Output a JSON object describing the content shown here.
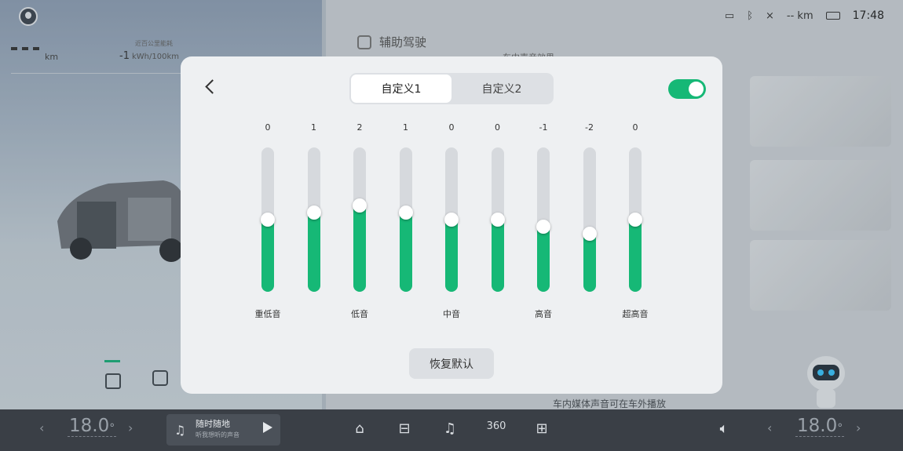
{
  "background": {
    "left": {
      "range_value": "– –",
      "range_unit": "km",
      "consumption_caption": "近百公里能耗",
      "consumption_value": "-1",
      "consumption_unit": "kWh/100km"
    },
    "right": {
      "assist_label": "辅助驾驶",
      "sound_caption": "车内声音效果",
      "note": "车内媒体声音可在车外播放"
    }
  },
  "status_bar": {
    "signal_x": "×",
    "range": "-- km",
    "time": "17:48"
  },
  "dialog": {
    "tabs": [
      {
        "label": "自定义1",
        "active": true
      },
      {
        "label": "自定义2",
        "active": false
      }
    ],
    "toggle_on": true,
    "accent_color": "#16b876",
    "bands": [
      {
        "value": "0",
        "label": "重低音",
        "level": 0.5
      },
      {
        "value": "1",
        "label": "",
        "level": 0.55
      },
      {
        "value": "2",
        "label": "低音",
        "level": 0.6
      },
      {
        "value": "1",
        "label": "",
        "level": 0.55
      },
      {
        "value": "0",
        "label": "中音",
        "level": 0.5
      },
      {
        "value": "0",
        "label": "",
        "level": 0.5
      },
      {
        "value": "-1",
        "label": "高音",
        "level": 0.45
      },
      {
        "value": "-2",
        "label": "",
        "level": 0.4
      },
      {
        "value": "0",
        "label": "超高音",
        "level": 0.5
      }
    ],
    "reset_label": "恢复默认"
  },
  "dock": {
    "temp_left": "18.0",
    "temp_right": "18.0",
    "degree": "°",
    "music_title": "随时随地",
    "music_subtitle": "听我想听的声音",
    "icon_360": "360"
  }
}
